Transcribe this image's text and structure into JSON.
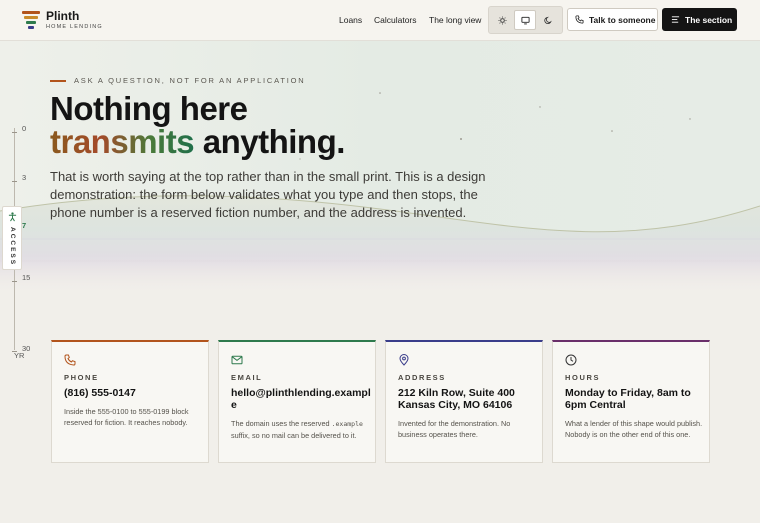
{
  "header": {
    "logo_name": "Plinth",
    "logo_sub": "HOME LENDING",
    "nav": [
      "Loans",
      "Calculators",
      "The long view"
    ],
    "talk_label": "Talk to someone",
    "section_label": "The section"
  },
  "hero": {
    "eyebrow": "ASK A QUESTION, NOT FOR AN APPLICATION",
    "title_line1": "Nothing here",
    "title_accent": "transmits",
    "title_rest": " anything.",
    "lede": "That is worth saying at the top rather than in the small print. This is a design demonstration: the form below validates what you type and then stops, the phone number is a reserved fiction number, and the address is invented."
  },
  "scale": {
    "ticks": [
      "0",
      "3",
      "7",
      "15",
      "30"
    ],
    "unit": "YR",
    "access_label": "ACCESS"
  },
  "cards": [
    {
      "label": "PHONE",
      "value": "(816) 555-0147",
      "desc": "Inside the 555-0100 to 555-0199 block reserved for fiction. It reaches nobody.",
      "color": "#b2541c"
    },
    {
      "label": "EMAIL",
      "value": "hello@plinthlending.example",
      "desc_before": "The domain uses the reserved",
      "desc_code": ".example",
      "desc_after": "suffix, so no mail can be delivered to it.",
      "color": "#2e7a4d"
    },
    {
      "label": "ADDRESS",
      "value": "212 Kiln Row, Suite 400 Kansas City, MO 64106",
      "desc": "Invented for the demonstration. No business operates there.",
      "color": "#3a3d8a"
    },
    {
      "label": "HOURS",
      "value": "Monday to Friday, 8am to 6pm Central",
      "desc": "What a lender of this shape would publish. Nobody is on the other end of this one.",
      "color": "#6a2f6a"
    }
  ]
}
